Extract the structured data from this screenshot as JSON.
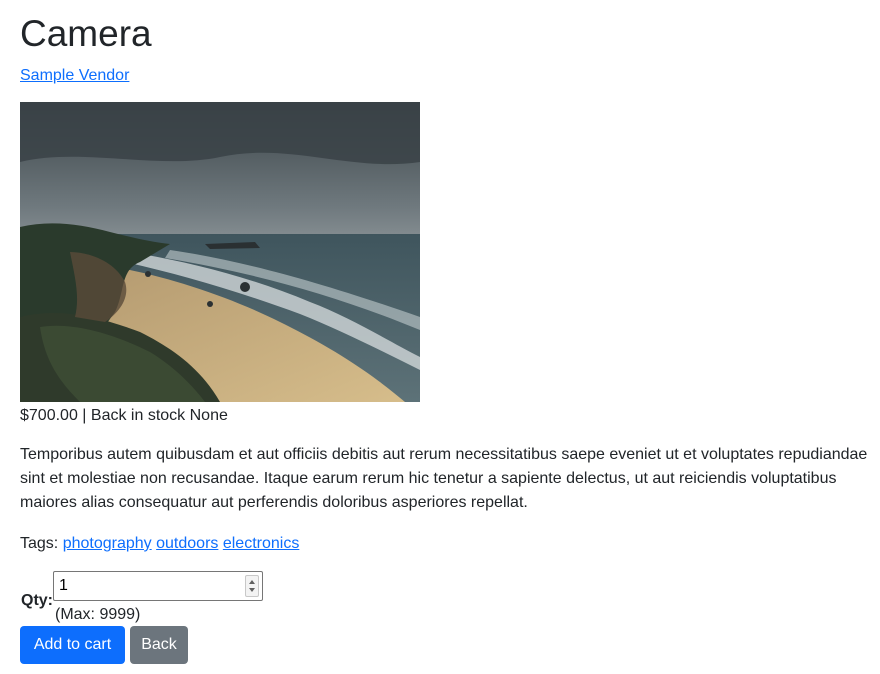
{
  "product": {
    "title": "Camera",
    "vendor": "Sample Vendor",
    "price": "$700.00",
    "separator": "|",
    "stock": "Back in stock None",
    "description": "Temporibus autem quibusdam et aut officiis debitis aut rerum necessitatibus saepe eveniet ut et voluptates repudiandae sint et molestiae non recusandae. Itaque earum rerum hic tenetur a sapiente delectus, ut aut reiciendis voluptatibus maiores alias consequatur aut perferendis doloribus asperiores repellat.",
    "image_alt": "coastal beach under stormy sky"
  },
  "tags": {
    "label": "Tags:",
    "items": [
      "photography",
      "outdoors",
      "electronics"
    ]
  },
  "quantity": {
    "label": "Qty:",
    "value": "1",
    "max_note": "(Max: 9999)"
  },
  "actions": {
    "add_to_cart": "Add to cart",
    "back": "Back"
  },
  "colors": {
    "link": "#0d6efd",
    "primary_button": "#0d6efd",
    "secondary_button": "#6c757d",
    "text": "#212529"
  }
}
